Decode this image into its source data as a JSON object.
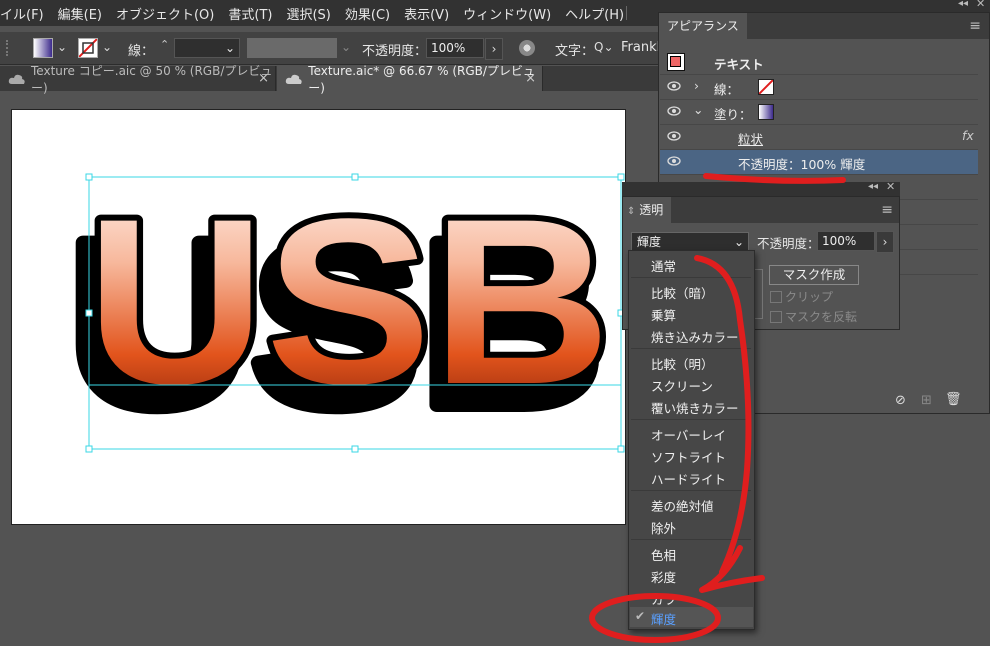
{
  "menubar": [
    "イル(F)",
    "編集(E)",
    "オブジェクト(O)",
    "書式(T)",
    "選択(S)",
    "効果(C)",
    "表示(V)",
    "ウィンドウ(W)",
    "ヘルプ(H)"
  ],
  "control": {
    "stroke_label": "線：",
    "opacity_label": "不透明度：",
    "opacity_value": "100%",
    "char_label": "文字：",
    "font_value": "Frankl"
  },
  "tabs": [
    {
      "label": "Texture コピー.aic @ 50 % (RGB/プレビュー)",
      "active": false
    },
    {
      "label": "Texture.aic* @ 66.67 % (RGB/プレビュー)",
      "active": true
    }
  ],
  "artwork": {
    "text": "USB"
  },
  "appearance": {
    "title": "アピアランス",
    "object_label": "テキスト",
    "stroke_label": "線：",
    "fill_label": "塗り：",
    "effect_label": "粒状",
    "fx": "fx",
    "opacity_row": "不透明度：100% 輝度"
  },
  "transparency": {
    "title": "透明",
    "blend_value": "輝度",
    "opacity_label": "不透明度：",
    "opacity_value": "100%",
    "mask_button": "マスク作成",
    "clip_label": "クリップ",
    "invert_label": "マスクを反転"
  },
  "blend_modes": {
    "group1": [
      "通常"
    ],
    "group2": [
      "比較（暗）",
      "乗算",
      "焼き込みカラー"
    ],
    "group3": [
      "比較（明）",
      "スクリーン",
      "覆い焼きカラー"
    ],
    "group4": [
      "オーバーレイ",
      "ソフトライト",
      "ハードライト"
    ],
    "group5": [
      "差の絶対値",
      "除外"
    ],
    "group6": [
      "色相",
      "彩度",
      "カラー",
      "輝度"
    ],
    "selected": "輝度"
  },
  "colors": {
    "accent_red": "#e01e1e",
    "selected_row": "#4b6584",
    "selected_text": "#5aa0ff",
    "guide_cyan": "#3ad7e6"
  }
}
